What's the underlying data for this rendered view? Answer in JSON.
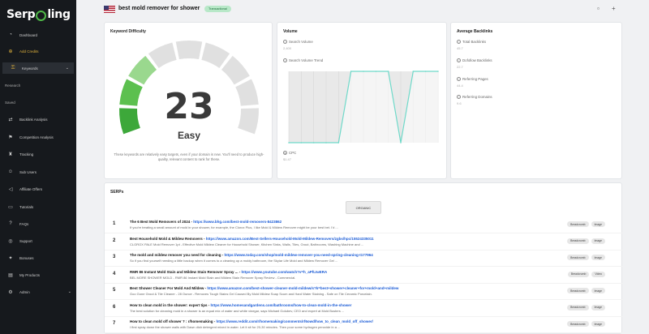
{
  "app": {
    "logo_text_a": "Serp",
    "logo_text_b": "ling"
  },
  "sidebar": {
    "items": [
      {
        "label": "Dashboard",
        "icon": "dashboard-icon"
      },
      {
        "label": "Add Credits",
        "icon": "coin-icon"
      },
      {
        "label": "Keywords",
        "icon": "key-icon"
      }
    ],
    "section_research": "Research",
    "section_saved": "Saved",
    "items2": [
      {
        "label": "Backlink Analysis",
        "icon": "link-icon"
      },
      {
        "label": "Competition Analysis",
        "icon": "competition-icon"
      },
      {
        "label": "Tracking",
        "icon": "trophy-icon"
      },
      {
        "label": "Sub Users",
        "icon": "users-icon"
      },
      {
        "label": "Affiliate Offers",
        "icon": "megaphone-icon"
      },
      {
        "label": "Tutorials",
        "icon": "tutorial-icon"
      },
      {
        "label": "FAQs",
        "icon": "question-icon"
      },
      {
        "label": "Support",
        "icon": "support-icon"
      },
      {
        "label": "Bonuses",
        "icon": "gift-icon"
      },
      {
        "label": "My Products",
        "icon": "products-icon"
      },
      {
        "label": "Admin",
        "icon": "admin-icon"
      }
    ]
  },
  "header": {
    "title": "best mold remover for shower",
    "badge": "Transactional"
  },
  "keyword_difficulty": {
    "title": "Keyword Difficulty",
    "score": "23",
    "score_value": 23,
    "label": "Easy",
    "description": "These keywords are relatively easy targets, even if your domain is new. You'll need to produce high-quality, relevant content to rank for these."
  },
  "volume": {
    "title": "Volume",
    "search_volume_label": "Search Volume",
    "search_volume": "2,400",
    "trend_label": "Search Volume Trend",
    "cpc_label": "CPC",
    "cpc": "$1.47"
  },
  "chart_data": {
    "type": "line",
    "values": [
      0,
      0,
      0,
      0,
      0,
      3,
      3,
      3,
      3,
      0,
      3,
      3,
      3
    ],
    "ylim": [
      0,
      3
    ]
  },
  "backlinks": {
    "title": "Average Backlinks",
    "items": [
      {
        "label": "Total Backlinks",
        "value": "45.7"
      },
      {
        "label": "Dofollow Backlinks",
        "value": "22.7"
      },
      {
        "label": "Referring Pages",
        "value": "44.4"
      },
      {
        "label": "Referring Domains",
        "value": "9.6"
      }
    ]
  },
  "serps": {
    "title": "SERPs",
    "tab": "ORGANIC",
    "rows": [
      {
        "n": "1",
        "title": "The 6 Best Mold Removers of 2024 - ",
        "url": "https://www.bhg.com/best-mold-removers-8423862",
        "snippet": "If you're treating a small amount of mold in your shower, for example, the Clorox Plus, I like Mold & Mildew Remover might be your best bet. I'd ...",
        "pills": [
          "Breadcrumb",
          "Image"
        ]
      },
      {
        "n": "2",
        "title": "Best Household Mold & Mildew Removers - ",
        "url": "https://www.amazon.com/Best-Sellers-Household-Mold-Mildew-Removers/zgbs/hpc/15524335011",
        "snippet": "CLOROX PALE Mold Remover 1pt - Effective Mold Mildew Cleaner for Household Shower, Kitchen Sinks, Walls, Tiles, Grout, Bathrooms, Washing Machine and ...",
        "pills": [
          "Breadcrumb",
          "Image"
        ]
      },
      {
        "n": "3",
        "title": "The mold and mildew remover you need for cleaning - ",
        "url": "https://www.today.com/shop/mold-mildew-remover-you-need-spring-cleaning-t177964",
        "snippet": "So if you find yourself needing a little backup when it comes to a cleaning up a moldy bathroom, the Skylar Life Mold and Mildew Remover Gel ...",
        "pills": [
          "Breadcrumb",
          "Image"
        ]
      },
      {
        "n": "4",
        "title": "RMR 86 Instant Mold Stain and Mildew Stain Remover Spray ... - ",
        "url": "https://www.youtube.com/watch?v=h_aPfLIwERA",
        "snippet": "BEL MORE SHOWER MOLD - RMR 86 Instant Mold Stain and Mildew Stain Remover Spray Review - Commercial.",
        "pills": [
          "Breadcrumb",
          "Video"
        ]
      },
      {
        "n": "5",
        "title": "Best Shower Cleaner For Mold And Mildew - ",
        "url": "https://www.amazon.com/best-shower-cleaner-mold-mildew/s?k=best+shower+cleaner+for+mold+and+mildew",
        "snippet": "Goo Gone Grout & Tile Cleaner - 28 Ounce - Removes Tough Stains Gel Caused By Mold Mildew Soap Scum and Hard Water Staining - Safe on Tile Ceramic Porcelain.",
        "pills": [
          "Breadcrumb",
          "Image"
        ]
      },
      {
        "n": "6",
        "title": "How to clean mold in the shower: expert tips - ",
        "url": "https://www.homesandgardens.com/bathrooms/how-to-clean-mold-in-the-shower",
        "snippet": "The best solution for cleaning mold in a shower is an equal mix of water and white vinegar, says Michael Golubev, CEO and expert at Mold Busters ...",
        "pills": [
          "Breadcrumb",
          "Image"
        ]
      },
      {
        "n": "7",
        "title": "How to clean mold off shower ? : r/homemaking - ",
        "url": "https://www.reddit.com/r/homemaking/comments/rf6owd/how_to_clean_mold_off_shower/",
        "snippet": "I first spray down the shower walls with Dawn dish detergent mixed in water. Let it sit for 20-30 minutes. Then pour some hydrogen peroxide in a ...",
        "pills": [
          "Breadcrumb",
          "Image"
        ]
      }
    ]
  },
  "colors": {
    "accent": "#3ca83c",
    "gauge_inactive": "#e0e0e0",
    "link": "#1a5bd6",
    "sidebar_bg": "#16191d",
    "trend_line": "#6fd9c9"
  }
}
